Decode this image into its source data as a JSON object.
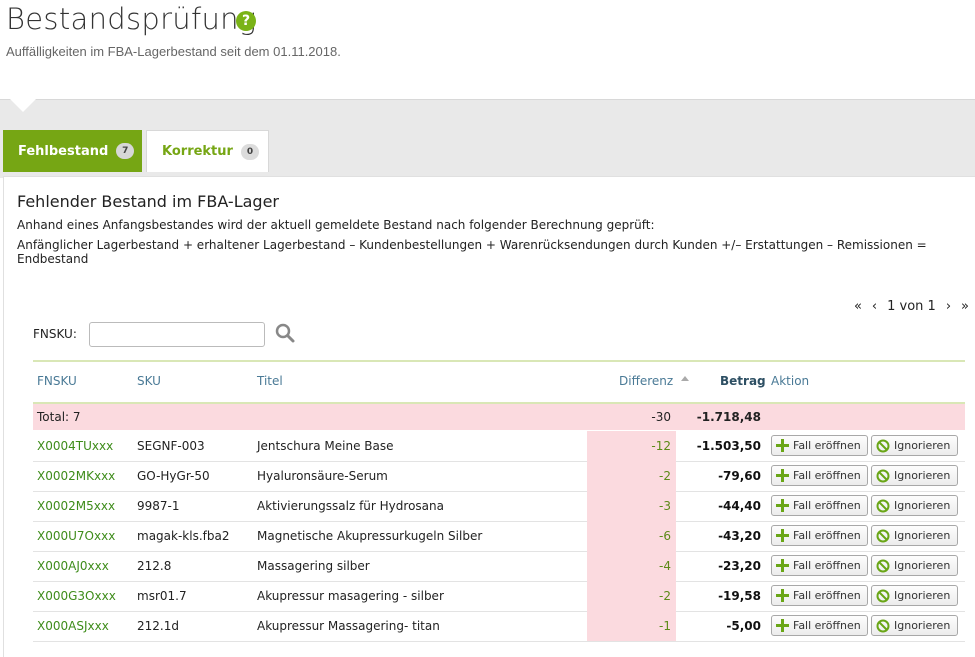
{
  "header": {
    "title": "Bestandsprüfung",
    "help_icon": "?",
    "subtitle": "Auffälligkeiten im FBA-Lagerbestand seit dem 01.11.2018."
  },
  "tabs": [
    {
      "label": "Fehlbestand",
      "count": "7",
      "active": true
    },
    {
      "label": "Korrektur",
      "count": "0",
      "active": false
    }
  ],
  "panel": {
    "title": "Fehlender Bestand im FBA-Lager",
    "desc1": "Anhand eines Anfangsbestandes wird der aktuell gemeldete Bestand nach folgender Berechnung geprüft:",
    "desc2": "Anfänglicher Lagerbestand + erhaltener Lagerbestand – Kundenbestellungen + Warenrücksendungen durch Kunden +/– Erstattungen – Remissionen = Endbestand"
  },
  "pager": {
    "first": "«",
    "prev": "‹",
    "text": "1 von 1",
    "next": "›",
    "last": "»"
  },
  "filter": {
    "label": "FNSKU:",
    "value": "",
    "placeholder": ""
  },
  "table": {
    "headers": {
      "fnsku": "FNSKU",
      "sku": "SKU",
      "title": "Titel",
      "diff": "Differenz",
      "amount": "Betrag",
      "action": "Aktion"
    },
    "total": {
      "label": "Total: 7",
      "diff": "-30",
      "amount": "-1.718,48"
    },
    "rows": [
      {
        "fnsku": "X0004TUxxx",
        "sku": "SEGNF-003",
        "title": "Jentschura Meine Base",
        "diff": "-12",
        "amount": "-1.503,50"
      },
      {
        "fnsku": "X0002MKxxx",
        "sku": "GO-HyGr-50",
        "title": "Hyaluronsäure-Serum",
        "diff": "-2",
        "amount": "-79,60"
      },
      {
        "fnsku": "X0002M5xxx",
        "sku": "9987-1",
        "title": "Aktivierungssalz für Hydrosana",
        "diff": "-3",
        "amount": "-44,40"
      },
      {
        "fnsku": "X000U7Oxxx",
        "sku": "magak-kls.fba2",
        "title": "Magnetische Akupressurkugeln Silber",
        "diff": "-6",
        "amount": "-43,20"
      },
      {
        "fnsku": "X000AJ0xxx",
        "sku": "212.8",
        "title": "Massagering silber",
        "diff": "-4",
        "amount": "-23,20"
      },
      {
        "fnsku": "X000G3Oxxx",
        "sku": "msr01.7",
        "title": "Akupressur masagering - silber",
        "diff": "-2",
        "amount": "-19,58"
      },
      {
        "fnsku": "X000ASJxxx",
        "sku": "212.1d",
        "title": "Akupressur Massagering- titan",
        "diff": "-1",
        "amount": "-5,00"
      }
    ],
    "buttons": {
      "open": "Fall eröffnen",
      "ignore": "Ignorieren"
    }
  },
  "colors": {
    "accent": "#76a614",
    "link": "#3e8c1a",
    "negative_bg": "#fbdadf",
    "header_text": "#4a7a96"
  }
}
